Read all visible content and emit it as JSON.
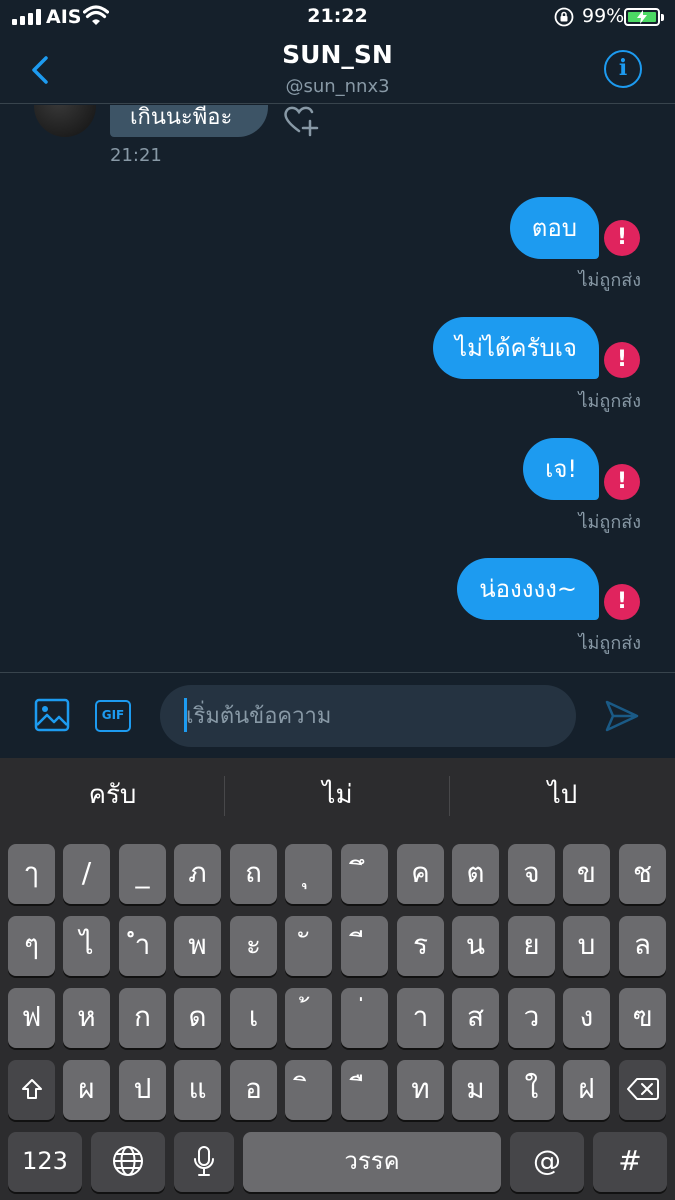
{
  "status_bar": {
    "carrier": "AIS",
    "time": "21:22",
    "battery": "99%"
  },
  "header": {
    "title": "SUN_SN",
    "handle": "@sun_nnx3"
  },
  "conversation": {
    "incoming": {
      "text": "เกินนะพี่อะ",
      "time": "21:21"
    },
    "outgoing": [
      {
        "text": "ตอบ",
        "status": "ไม่ถูกส่ง"
      },
      {
        "text": "ไม่ได้ครับเจ",
        "status": "ไม่ถูกส่ง"
      },
      {
        "text": "เจ!",
        "status": "ไม่ถูกส่ง"
      },
      {
        "text": "น่องงงง~",
        "status": "ไม่ถูกส่ง"
      }
    ],
    "error_glyph": "!"
  },
  "composer": {
    "gif_label": "GIF",
    "placeholder": "เริ่มต้นข้อความ",
    "icons": [
      "image-icon",
      "gif-icon",
      "send-icon"
    ]
  },
  "keyboard": {
    "suggestions": [
      "ครับ",
      "ไม่",
      "ไป"
    ],
    "row1": [
      "ๅ",
      "/",
      "_",
      "ภ",
      "ถ",
      "ุ",
      "ึ",
      "ค",
      "ต",
      "จ",
      "ข",
      "ช"
    ],
    "row2": [
      "ๆ",
      "ไ",
      "ำ",
      "พ",
      "ะ",
      "ั",
      "ี",
      "ร",
      "น",
      "ย",
      "บ",
      "ล"
    ],
    "row3": [
      "ฟ",
      "ห",
      "ก",
      "ด",
      "เ",
      "้",
      "่",
      "า",
      "ส",
      "ว",
      "ง",
      "ฃ"
    ],
    "row4": [
      "ผ",
      "ป",
      "แ",
      "อ",
      "ิ",
      "ื",
      "ท",
      "ม",
      "ใ",
      "ฝ"
    ],
    "numbers_key": "123",
    "space_key": "วรรค",
    "at_key": "@",
    "hash_key": "#"
  },
  "colors": {
    "background": "#15202b",
    "accent": "#1d9bf0",
    "error": "#e0245e",
    "keyboard": "#2c2c2e"
  }
}
